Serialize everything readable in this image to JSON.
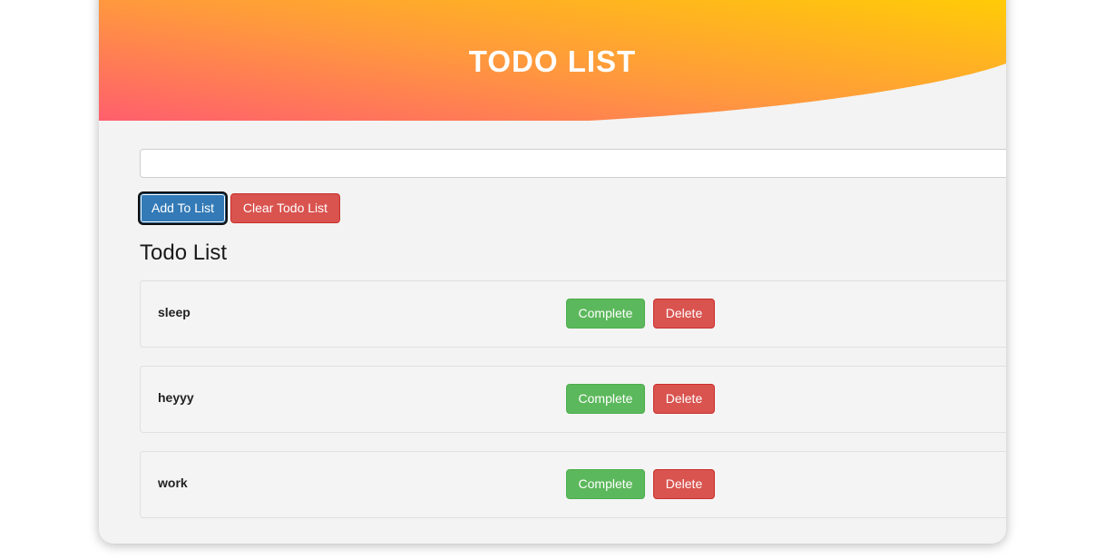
{
  "header": {
    "title": "TODO LIST"
  },
  "input": {
    "value": "",
    "placeholder": ""
  },
  "actions": {
    "add_label": "Add To List",
    "clear_label": "Clear Todo List"
  },
  "list": {
    "title": "Todo List",
    "complete_label": "Complete",
    "delete_label": "Delete",
    "items": [
      {
        "text": "sleep"
      },
      {
        "text": "heyyy"
      },
      {
        "text": "work"
      }
    ]
  },
  "colors": {
    "gradient_start": "#ff5f6d",
    "gradient_end": "#ffd200",
    "primary": "#337ab7",
    "danger": "#d9534f",
    "success": "#5cb85c",
    "panel_bg": "#f3f3f3"
  }
}
